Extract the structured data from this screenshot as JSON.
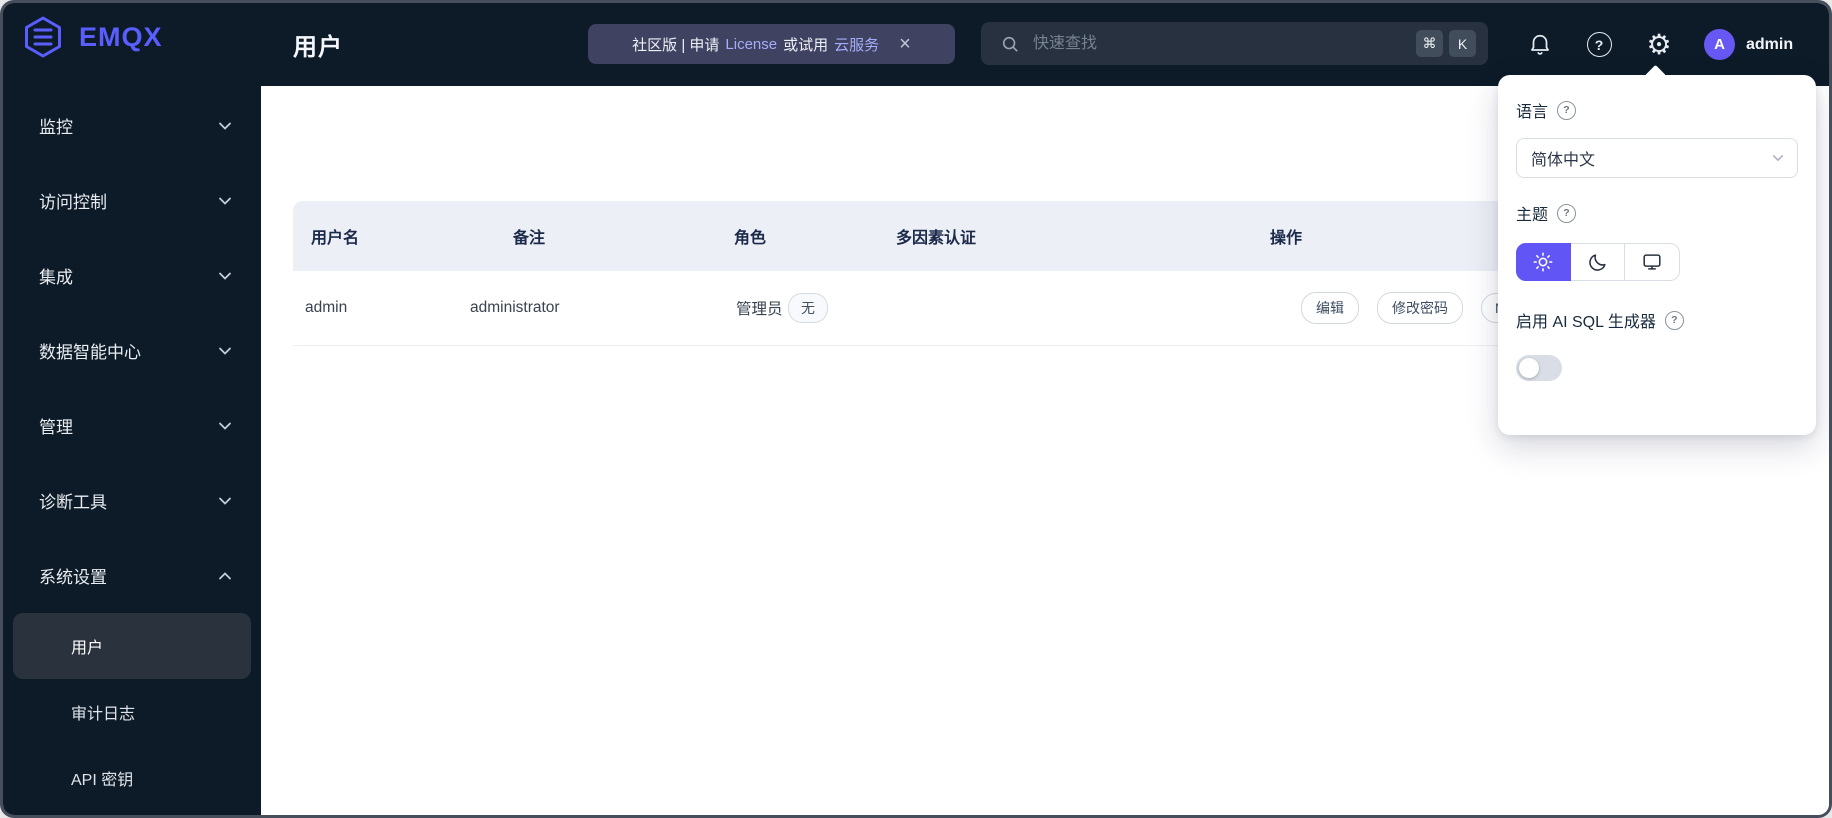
{
  "brand": {
    "name": "EMQX"
  },
  "icons": {
    "help_glyph": "?",
    "gear_glyph": "⚙",
    "close_glyph": "×"
  },
  "sidebar": {
    "items": [
      {
        "label": "监控"
      },
      {
        "label": "访问控制"
      },
      {
        "label": "集成"
      },
      {
        "label": "数据智能中心"
      },
      {
        "label": "管理"
      },
      {
        "label": "诊断工具"
      },
      {
        "label": "系统设置",
        "expanded": true,
        "children": [
          {
            "label": "用户",
            "selected": true
          },
          {
            "label": "审计日志"
          },
          {
            "label": "API 密钥"
          }
        ]
      }
    ]
  },
  "header": {
    "title": "用户",
    "banner": {
      "text1": "社区版 | 申请",
      "license_link": "License",
      "text2": "或试用",
      "cloud_link": "云服务"
    },
    "search": {
      "placeholder": "快速查找",
      "keys": [
        "⌘",
        "K"
      ]
    },
    "user": {
      "initial": "A",
      "name": "admin"
    }
  },
  "table": {
    "columns": [
      "用户名",
      "备注",
      "角色",
      "多因素认证",
      "操作"
    ],
    "rows": [
      {
        "username": "admin",
        "note": "administrator",
        "role": "管理员",
        "mfa": "无",
        "actions": [
          "编辑",
          "修改密码",
          "M"
        ]
      }
    ]
  },
  "panel": {
    "language": {
      "label": "语言",
      "value": "简体中文"
    },
    "theme": {
      "label": "主题",
      "selected": "light",
      "options": [
        "light",
        "dark",
        "system"
      ]
    },
    "ai_sql": {
      "label": "启用 AI SQL 生成器",
      "enabled": false
    }
  },
  "colors": {
    "accent": "#5A5EFF",
    "panel_accent": "#6155F6",
    "sidebar_bg": "#0D1B28",
    "banner_bg": "#3F4261",
    "table_header_bg": "#EDEFF6"
  }
}
